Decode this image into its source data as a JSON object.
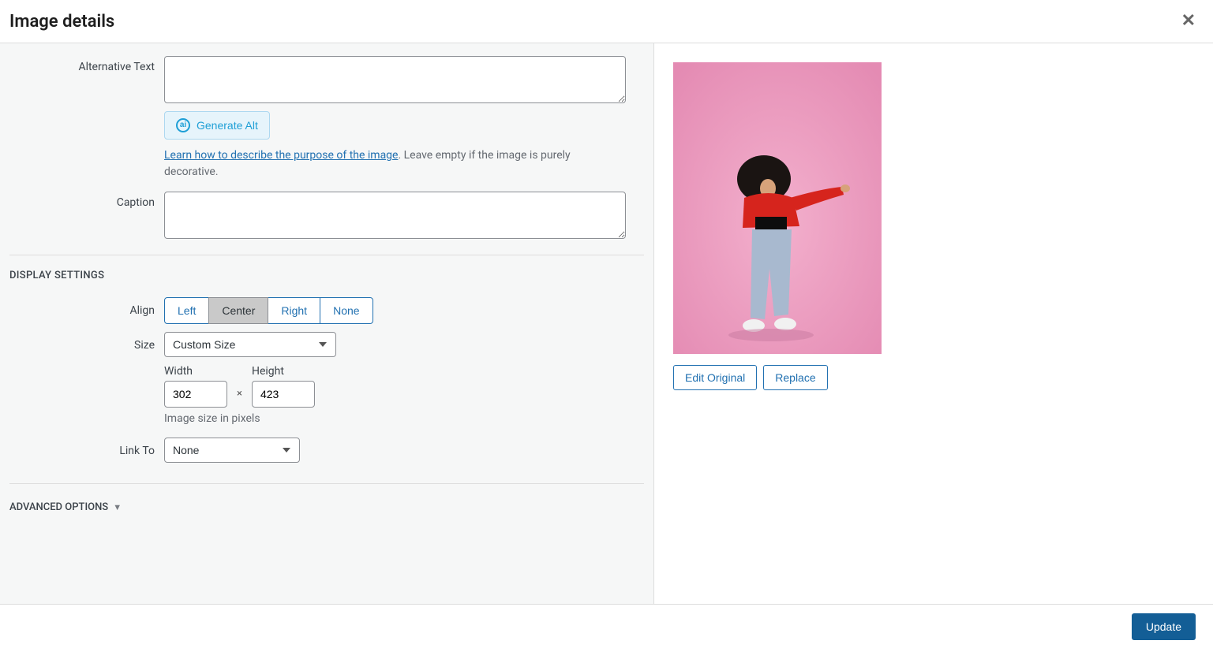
{
  "header": {
    "title": "Image details"
  },
  "altText": {
    "label": "Alternative Text",
    "value": "",
    "generateButton": "Generate Alt",
    "helpLink": "Learn how to describe the purpose of the image",
    "helpRest": ". Leave empty if the image is purely decorative."
  },
  "caption": {
    "label": "Caption",
    "value": ""
  },
  "displaySettings": {
    "title": "DISPLAY SETTINGS",
    "align": {
      "label": "Align",
      "options": [
        "Left",
        "Center",
        "Right",
        "None"
      ],
      "selected": "Center"
    },
    "size": {
      "label": "Size",
      "selected": "Custom Size",
      "widthLabel": "Width",
      "heightLabel": "Height",
      "width": "302",
      "height": "423",
      "hint": "Image size in pixels",
      "x": "×"
    },
    "linkTo": {
      "label": "Link To",
      "selected": "None"
    }
  },
  "advanced": {
    "label": "ADVANCED OPTIONS"
  },
  "preview": {
    "editOriginal": "Edit Original",
    "replace": "Replace"
  },
  "footer": {
    "update": "Update"
  }
}
